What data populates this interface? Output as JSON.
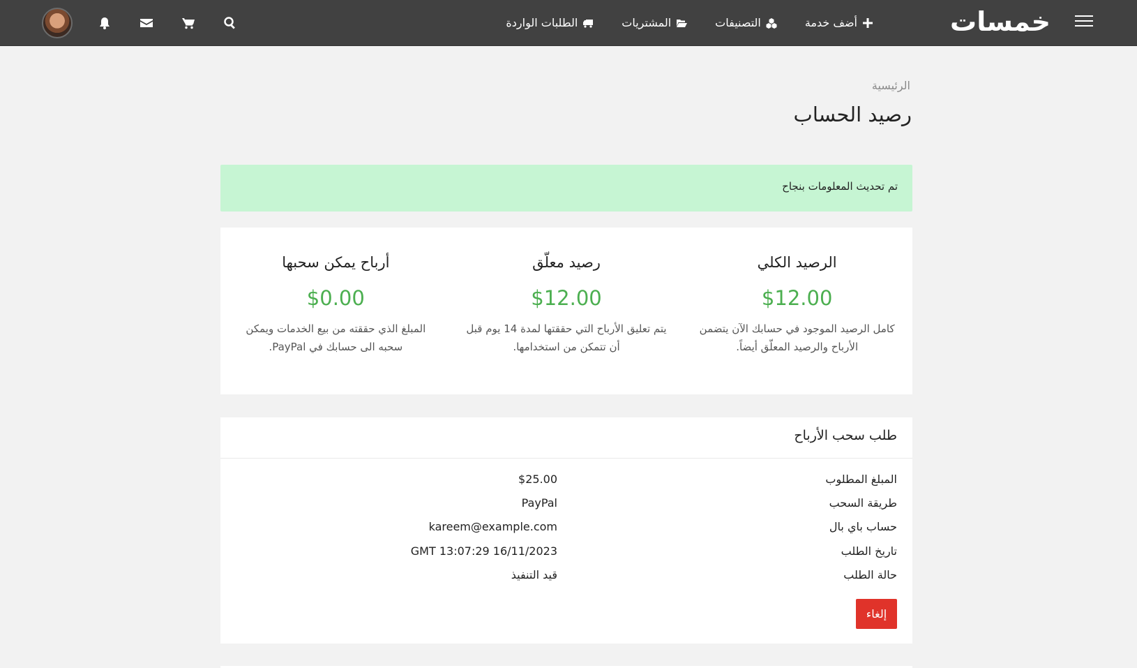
{
  "topbar": {
    "logo": "خمسات",
    "nav": [
      {
        "label": "أضف خدمة",
        "icon": "plus-icon"
      },
      {
        "label": "التصنيفات",
        "icon": "cubes-icon"
      },
      {
        "label": "المشتريات",
        "icon": "folder-open-icon"
      },
      {
        "label": "الطلبات الواردة",
        "icon": "truck-icon"
      }
    ],
    "icons": [
      "avatar",
      "bell-icon",
      "envelope-icon",
      "cart-icon",
      "search-icon"
    ]
  },
  "breadcrumb": "الرئيسية",
  "page_title": "رصيد الحساب",
  "alert": "تم تحديث المعلومات بنجاح",
  "stats": [
    {
      "title": "الرصيد الكلي",
      "amount": "$12.00",
      "desc": "كامل الرصيد الموجود في حسابك الآن يتضمن الأرباح والرصيد المعلّق أيضاً."
    },
    {
      "title": "رصيد معلّق",
      "amount": "$12.00",
      "desc": "يتم تعليق الأرباح التي حققتها لمدة 14 يوم قبل أن تتمكن من استخدامها."
    },
    {
      "title": "أرباح يمكن سحبها",
      "amount": "$0.00",
      "desc": "المبلغ الذي حققته من بيع الخدمات ويمكن سحبه الى حسابك في PayPal."
    }
  ],
  "withdraw": {
    "title": "طلب سحب الأرباح",
    "rows": [
      {
        "label": "المبلغ المطلوب",
        "value": "$25.00"
      },
      {
        "label": "طريقة السحب",
        "value": "PayPal"
      },
      {
        "label": "حساب باي بال",
        "value": "kareem@example.com"
      },
      {
        "label": "تاريخ الطلب",
        "value": "GMT 13:07:29 16/11/2023"
      },
      {
        "label": "حالة الطلب",
        "value": "قيد التنفيذ"
      }
    ],
    "cancel_label": "إلغاء"
  },
  "colors": {
    "topbar": "#414141",
    "accent_green": "#4caf50",
    "alert_bg": "#c6f5d3",
    "cancel_red": "#e0332a",
    "logo_accent": "#f6ab21"
  }
}
